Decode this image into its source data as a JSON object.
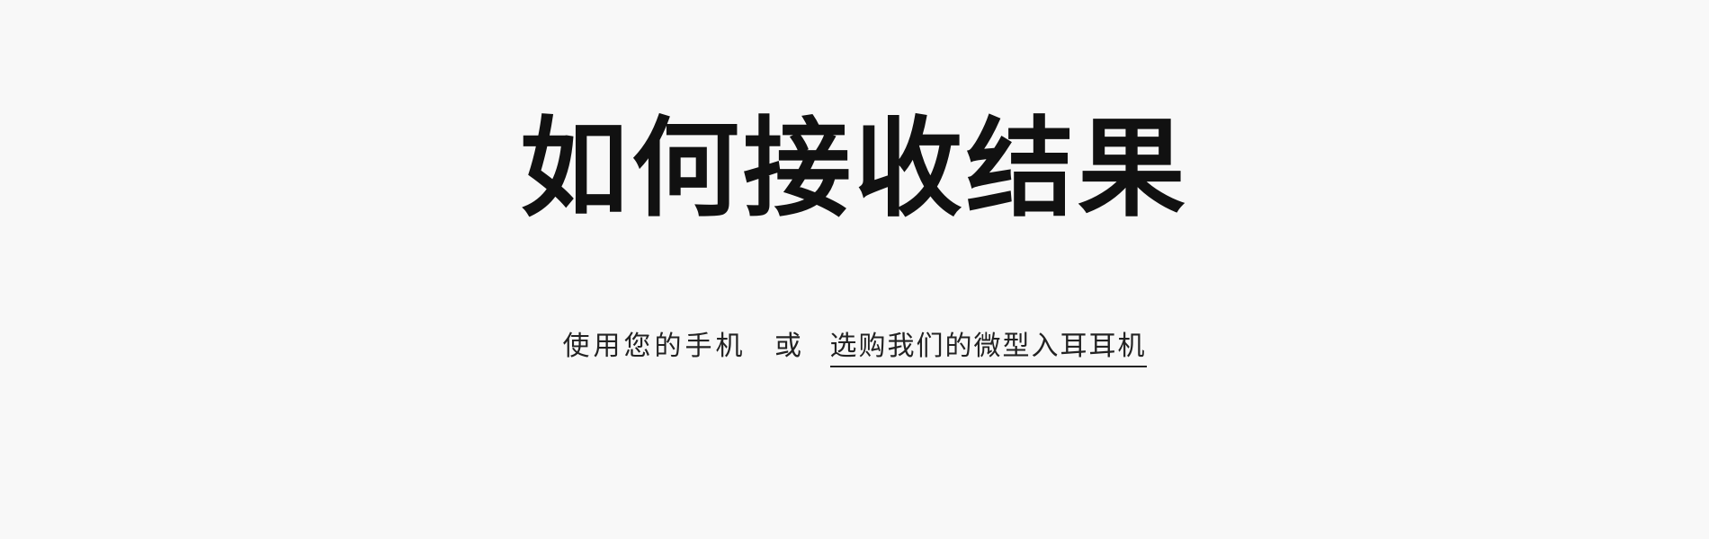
{
  "hero": {
    "title": "如何接收结果",
    "subtitle_prefix": "使用您的手机",
    "subtitle_or": "或",
    "subtitle_link": "选购我们的微型入耳耳机"
  },
  "colors": {
    "background": "#f8f8f8",
    "text": "#111111"
  }
}
